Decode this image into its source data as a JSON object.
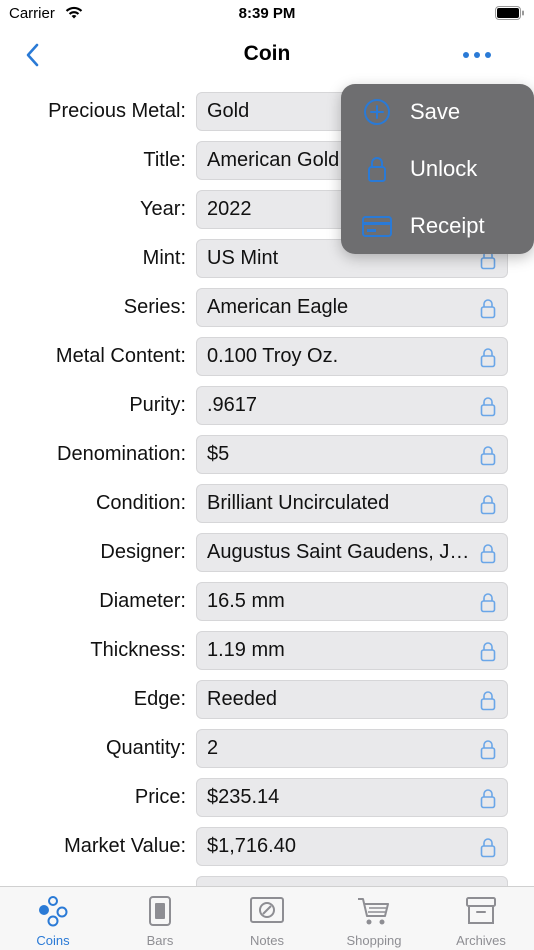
{
  "status_bar": {
    "carrier": "Carrier",
    "time": "8:39 PM"
  },
  "nav": {
    "title": "Coin",
    "back_icon": "chevron-left-icon",
    "more_icon": "ellipsis-icon"
  },
  "fields": [
    {
      "label": "Precious Metal:",
      "value": "Gold"
    },
    {
      "label": "Title:",
      "value": "American Gold Eagle"
    },
    {
      "label": "Year:",
      "value": "2022"
    },
    {
      "label": "Mint:",
      "value": "US Mint"
    },
    {
      "label": "Series:",
      "value": "American Eagle"
    },
    {
      "label": "Metal Content:",
      "value": "0.100 Troy Oz."
    },
    {
      "label": "Purity:",
      "value": ".9617"
    },
    {
      "label": "Denomination:",
      "value": "$5"
    },
    {
      "label": "Condition:",
      "value": "Brilliant Uncirculated"
    },
    {
      "label": "Designer:",
      "value": "Augustus Saint Gaudens, Jen..."
    },
    {
      "label": "Diameter:",
      "value": "16.5 mm"
    },
    {
      "label": "Thickness:",
      "value": "1.19 mm"
    },
    {
      "label": "Edge:",
      "value": "Reeded"
    },
    {
      "label": "Quantity:",
      "value": "2"
    },
    {
      "label": "Price:",
      "value": "$235.14"
    },
    {
      "label": "Market Value:",
      "value": "$1,716.40"
    },
    {
      "label": "",
      "value": ""
    }
  ],
  "menu": {
    "items": [
      {
        "label": "Save",
        "icon": "plus-circle-icon"
      },
      {
        "label": "Unlock",
        "icon": "lock-icon"
      },
      {
        "label": "Receipt",
        "icon": "credit-card-icon"
      }
    ]
  },
  "tabs": [
    {
      "label": "Coins",
      "icon": "coins-icon",
      "active": true
    },
    {
      "label": "Bars",
      "icon": "bar-icon",
      "active": false
    },
    {
      "label": "Notes",
      "icon": "note-icon",
      "active": false
    },
    {
      "label": "Shopping",
      "icon": "cart-icon",
      "active": false
    },
    {
      "label": "Archives",
      "icon": "archive-box-icon",
      "active": false
    }
  ],
  "colors": {
    "accent": "#2a7ad6",
    "field_bg": "#e9e9eb",
    "menu_bg": "#6e6e70",
    "inactive_tab": "#8e8e93"
  }
}
